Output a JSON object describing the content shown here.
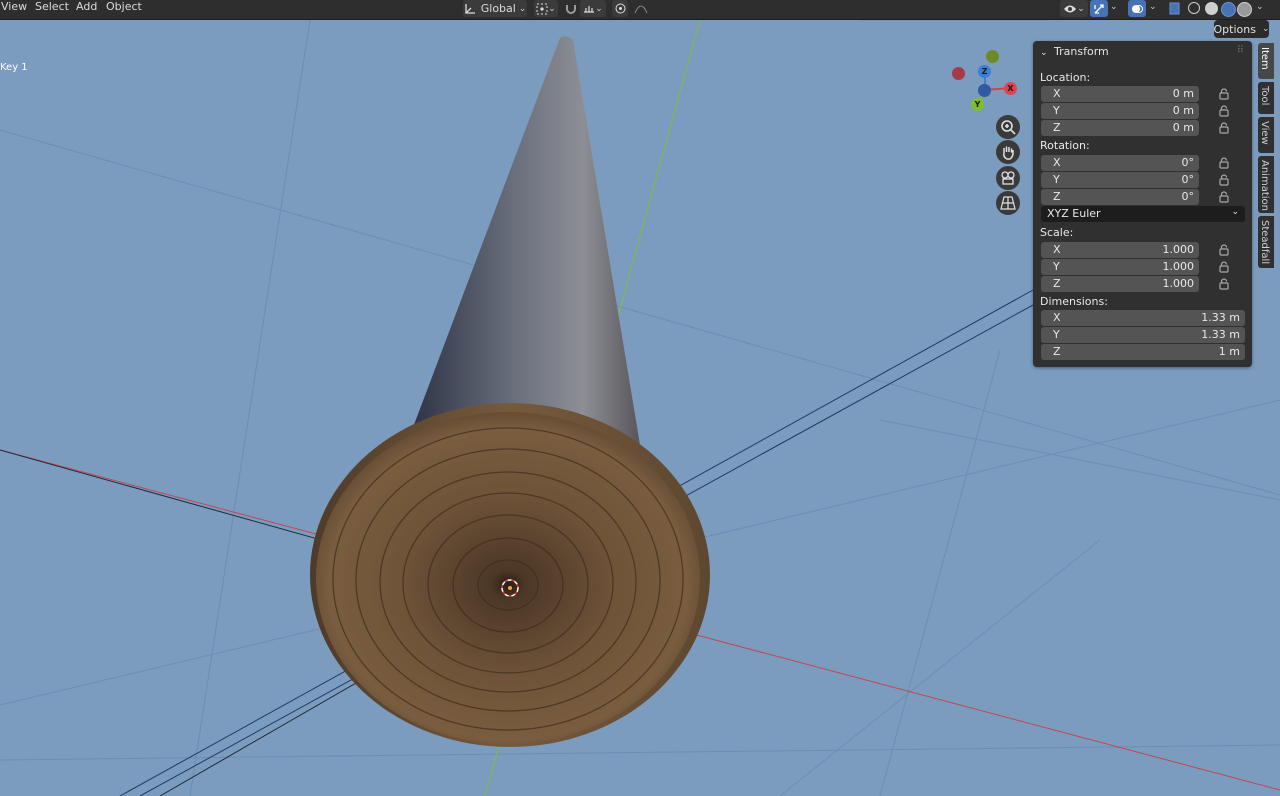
{
  "header": {
    "menus": [
      "View",
      "Select",
      "Add",
      "Object"
    ],
    "orientation": "Global"
  },
  "viewport": {
    "keyframe_label": "Key 1"
  },
  "options_label": "Options",
  "gizmo": {
    "axes": [
      "Z",
      "X",
      "Y"
    ]
  },
  "panel": {
    "title": "Transform",
    "location_label": "Location:",
    "location": [
      {
        "axis": "X",
        "value": "0 m"
      },
      {
        "axis": "Y",
        "value": "0 m"
      },
      {
        "axis": "Z",
        "value": "0 m"
      }
    ],
    "rotation_label": "Rotation:",
    "rotation": [
      {
        "axis": "X",
        "value": "0°"
      },
      {
        "axis": "Y",
        "value": "0°"
      },
      {
        "axis": "Z",
        "value": "0°"
      }
    ],
    "rotation_mode": "XYZ Euler",
    "scale_label": "Scale:",
    "scale": [
      {
        "axis": "X",
        "value": "1.000"
      },
      {
        "axis": "Y",
        "value": "1.000"
      },
      {
        "axis": "Z",
        "value": "1.000"
      }
    ],
    "dimensions_label": "Dimensions:",
    "dimensions": [
      {
        "axis": "X",
        "value": "1.33 m"
      },
      {
        "axis": "Y",
        "value": "1.33 m"
      },
      {
        "axis": "Z",
        "value": "1 m"
      }
    ]
  },
  "side_tabs": [
    "Item",
    "Tool",
    "View",
    "Animation",
    "Steadfall"
  ],
  "colors": {
    "viewport_bg": "#7b9cbf",
    "x_axis": "#d0424f",
    "y_axis": "#7fbf2a",
    "z_axis": "#3a7fd8",
    "active_blue": "#4772b3"
  }
}
